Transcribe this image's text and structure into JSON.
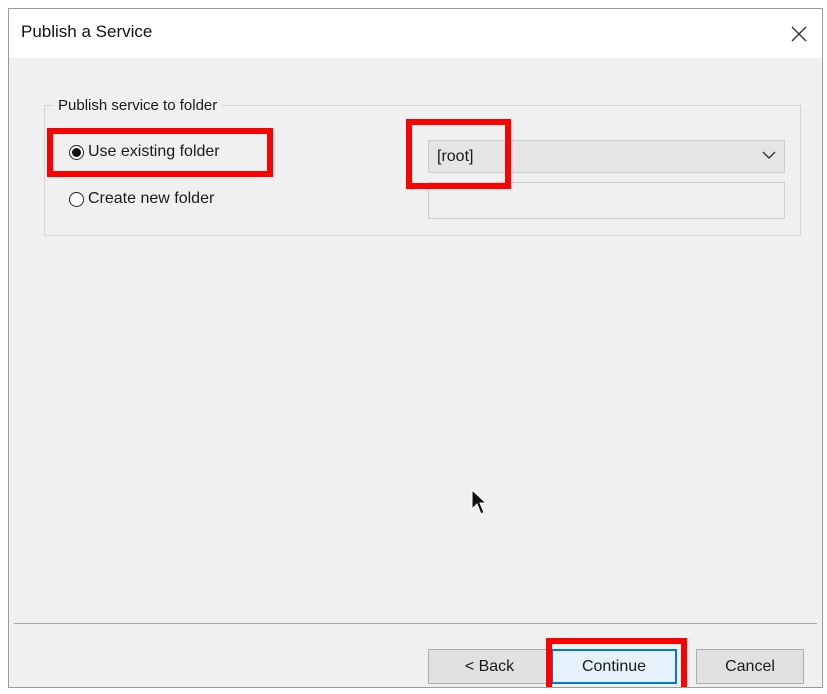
{
  "window": {
    "title": "Publish a Service",
    "close_icon": "close-icon"
  },
  "group": {
    "legend": "Publish service to folder",
    "options": [
      {
        "label": "Use existing folder",
        "selected": true
      },
      {
        "label": "Create new folder",
        "selected": false
      }
    ],
    "folder_select": {
      "value": "[root]",
      "icon": "chevron-down-icon"
    },
    "new_folder_input": {
      "value": ""
    }
  },
  "buttons": {
    "back": "< Back",
    "continue": "Continue",
    "cancel": "Cancel"
  },
  "colors": {
    "highlight": "#ff0000",
    "dialog_background": "#f0f0f0",
    "primary_button_border": "#0078d7"
  }
}
